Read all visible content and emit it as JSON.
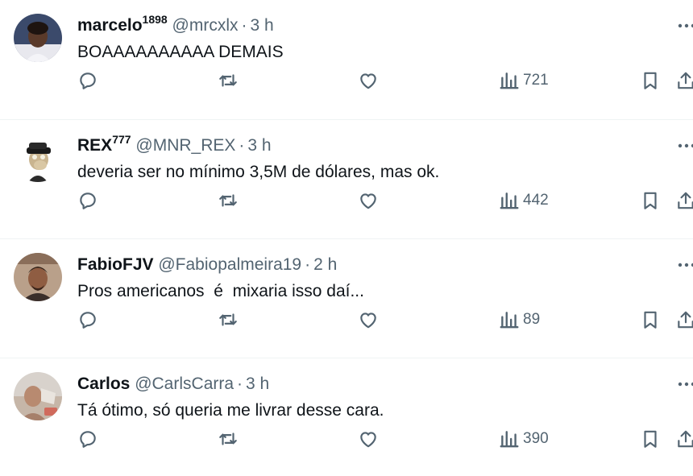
{
  "tweets": [
    {
      "name": "marcelo",
      "name_sup": "1898",
      "handle": "@mrcxlx",
      "time": "3 h",
      "text": "BOAAAAAAAAAA DEMAIS",
      "views": "721"
    },
    {
      "name": "REX",
      "name_sup": "777",
      "handle": "@MNR_REX",
      "time": "3 h",
      "text": "deveria ser no mínimo 3,5M de dólares, mas ok.",
      "views": "442"
    },
    {
      "name": "FabioFJV",
      "name_sup": "",
      "handle": "@Fabiopalmeira19",
      "time": "2 h",
      "text": "Pros americanos  é  mixaria isso daí...",
      "views": "89"
    },
    {
      "name": "Carlos",
      "name_sup": "",
      "handle": "@CarlsCarra",
      "time": "3 h",
      "text": "Tá ótimo, só queria me livrar desse cara.",
      "views": "390"
    }
  ],
  "separator": "·",
  "icons": {
    "reply": "reply-icon",
    "retweet": "retweet-icon",
    "like": "heart-icon",
    "views": "views-icon",
    "bookmark": "bookmark-icon",
    "share": "share-icon",
    "more": "more-icon"
  },
  "colors": {
    "text": "#0f1419",
    "secondary": "#536471",
    "divider": "#eff3f4"
  }
}
